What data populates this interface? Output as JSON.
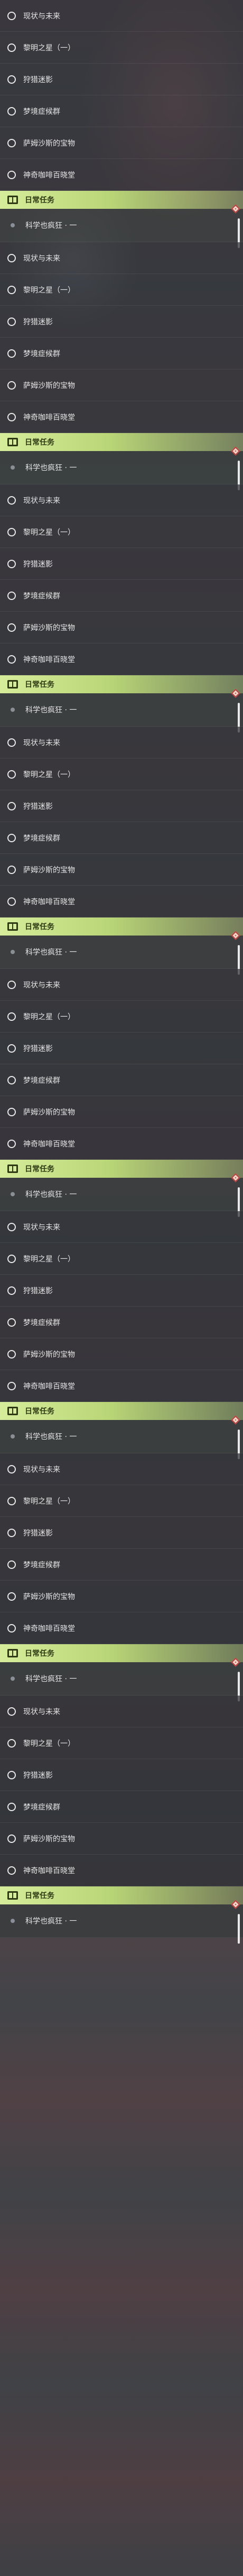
{
  "tasks": [
    "现状与未来",
    "黎明之星（一）",
    "狩猎迷影",
    "梦境症候群",
    "萨姆沙斯的宝物",
    "神奇咖啡百晓堂"
  ],
  "daily": {
    "header": "日常任务",
    "task": "科学也疯狂 · 一",
    "book_icon": "book-icon",
    "accent": "#b9d677",
    "badge_color": "#c23a3a"
  },
  "repeat_count": 8
}
